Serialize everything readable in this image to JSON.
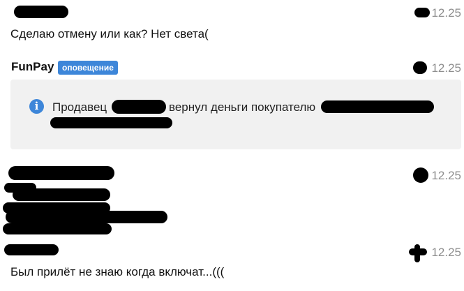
{
  "messages": [
    {
      "time": "12.25",
      "text": "Сделаю отмену или как? Нет света("
    },
    {
      "sender": "FunPay",
      "badge": "оповещение",
      "time": "12.25",
      "notice": {
        "prefix": "Продавец",
        "middle": "вернул деньги покупателю",
        "icon": "info-icon"
      }
    },
    {
      "time": "12.25"
    },
    {
      "time": "12.25",
      "text": "Был прилёт не знаю когда включат...((("
    }
  ],
  "colors": {
    "badge": "#3d86d9",
    "notice_bg": "#f1f1f1",
    "time": "#8e8e8e"
  }
}
